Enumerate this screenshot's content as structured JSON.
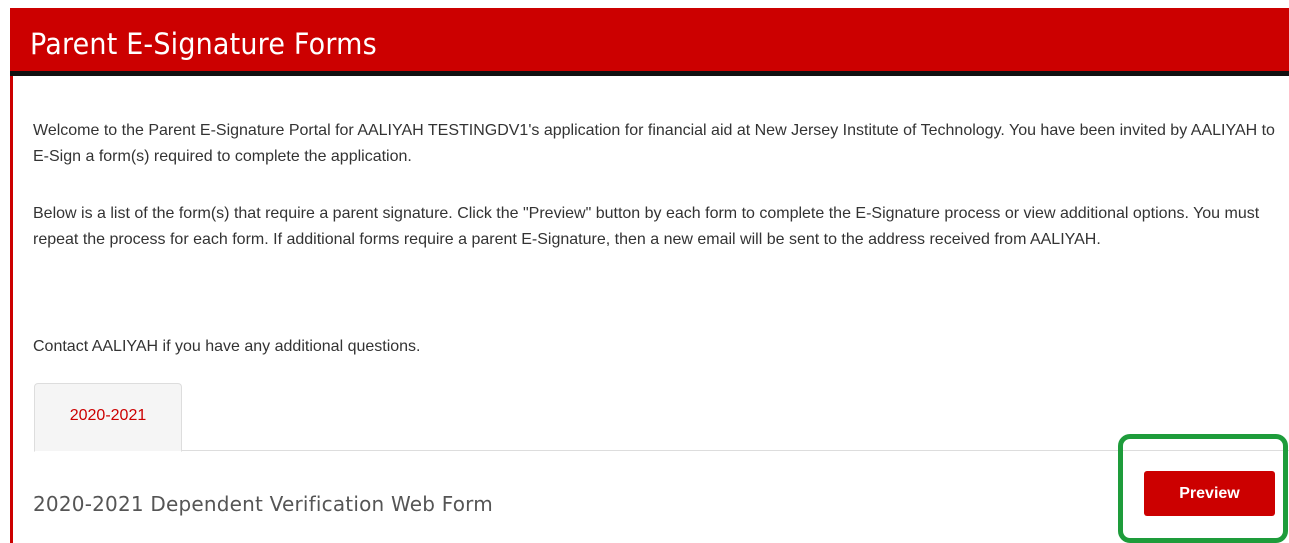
{
  "header": {
    "title": "Parent E-Signature Forms"
  },
  "intro": {
    "paragraph1": "Welcome to the Parent E-Signature Portal for AALIYAH TESTINGDV1's application for financial aid at New Jersey Institute of Technology. You have been invited by AALIYAH to E-Sign a form(s) required to complete the application.",
    "paragraph2": "Below is a list of the form(s) that require a parent signature. Click the \"Preview\" button by each form to complete the E-Signature process or view additional options. You must repeat the process for each form. If additional forms require a parent E-Signature, then a new email will be sent to the address received from AALIYAH.",
    "paragraph3": "Contact AALIYAH if you have any additional questions."
  },
  "tabs": [
    {
      "label": "2020-2021",
      "active": true
    }
  ],
  "forms": [
    {
      "title": "2020-2021 Dependent Verification Web Form",
      "button_label": "Preview"
    }
  ],
  "colors": {
    "brand": "#cc0000",
    "header_rule": "#111111",
    "highlight": "#1e9c3b"
  }
}
